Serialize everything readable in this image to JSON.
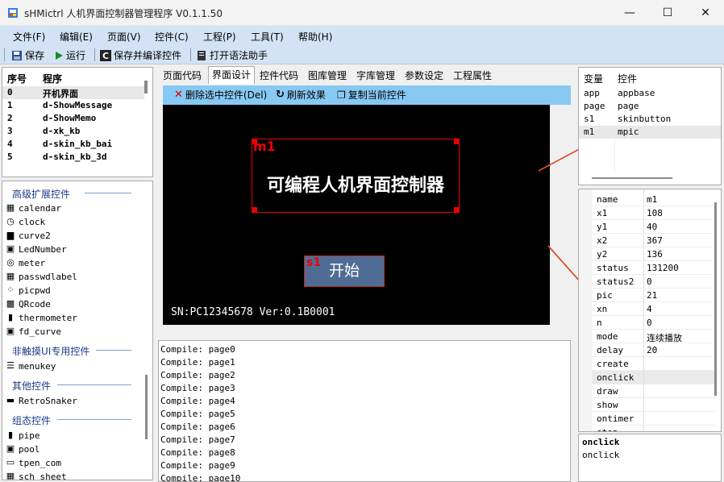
{
  "window": {
    "title": "sHMictrl 人机界面控制器管理程序 V0.1.1.50",
    "min": "—",
    "max": "☐",
    "close": "✕"
  },
  "menu": [
    "文件(F)",
    "编辑(E)",
    "页面(V)",
    "控件(C)",
    "工程(P)",
    "工具(T)",
    "帮助(H)"
  ],
  "toolbar": {
    "save": "保存",
    "run": "运行",
    "save_compile": "保存并编译控件",
    "syntax": "打开语法助手"
  },
  "programs": {
    "header": [
      "序号",
      "程序"
    ],
    "rows": [
      [
        "0",
        "开机界面"
      ],
      [
        "1",
        "d-ShowMessage"
      ],
      [
        "2",
        "d-ShowMemo"
      ],
      [
        "3",
        "d-xk_kb"
      ],
      [
        "4",
        "d-skin_kb_bai"
      ],
      [
        "5",
        "d-skin_kb_3d"
      ]
    ]
  },
  "toolbox": {
    "groups": [
      {
        "title": "高级扩展控件",
        "items": [
          {
            "label": "calendar",
            "icon": "▦"
          },
          {
            "label": "clock",
            "icon": "◷"
          },
          {
            "label": "curve2",
            "icon": "▆"
          },
          {
            "label": "LedNumber",
            "icon": "▣"
          },
          {
            "label": "meter",
            "icon": "◎"
          },
          {
            "label": "passwdlabel",
            "icon": "▦"
          },
          {
            "label": "picpwd",
            "icon": "⁘"
          },
          {
            "label": "QRcode",
            "icon": "▩"
          },
          {
            "label": "thermometer",
            "icon": "▮"
          },
          {
            "label": "fd_curve",
            "icon": "▣"
          }
        ]
      },
      {
        "title": "非触摸UI专用控件",
        "items": [
          {
            "label": "menukey",
            "icon": "☰"
          }
        ]
      },
      {
        "title": "其他控件",
        "items": [
          {
            "label": "RetroSnaker",
            "icon": "▬"
          }
        ]
      },
      {
        "title": "组态控件",
        "items": [
          {
            "label": "pipe",
            "icon": "▮"
          },
          {
            "label": "pool",
            "icon": "▣"
          },
          {
            "label": "tpen_com",
            "icon": "▭"
          },
          {
            "label": "sch_sheet",
            "icon": "▦"
          }
        ]
      }
    ]
  },
  "tabs": [
    "页面代码",
    "界面设计",
    "控件代码",
    "图库管理",
    "字库管理",
    "参数设定",
    "工程属性"
  ],
  "designbar": {
    "delete": "删除选中控件(Del)",
    "refresh": "刷新效果",
    "copy": "复制当前控件"
  },
  "canvas": {
    "m1_label": "m1",
    "m1_text": "可编程人机界面控制器",
    "s1_label": "s1",
    "s1_text": "开始",
    "sn": "SN:PC12345678 Ver:0.1B0001"
  },
  "log": [
    "Compile: page0",
    "Compile: page1",
    "Compile: page2",
    "Compile: page3",
    "Compile: page4",
    "Compile: page5",
    "Compile: page6",
    "Compile: page7",
    "Compile: page8",
    "Compile: page9",
    "Compile: page10"
  ],
  "vars": {
    "header": [
      "变量",
      "控件"
    ],
    "rows": [
      [
        "app",
        "appbase"
      ],
      [
        "page",
        "page"
      ],
      [
        "s1",
        "skinbutton"
      ],
      [
        "m1",
        "mpic"
      ]
    ]
  },
  "props": [
    [
      "name",
      "m1"
    ],
    [
      "x1",
      "108"
    ],
    [
      "y1",
      "40"
    ],
    [
      "x2",
      "367"
    ],
    [
      "y2",
      "136"
    ],
    [
      "status",
      "131200"
    ],
    [
      "status2",
      "0"
    ],
    [
      "pic",
      "21"
    ],
    [
      "xn",
      "4"
    ],
    [
      "n",
      "0"
    ],
    [
      "mode",
      "连续播放"
    ],
    [
      "delay",
      "20"
    ],
    [
      "create",
      ""
    ],
    [
      "onclick",
      ""
    ],
    [
      "draw",
      ""
    ],
    [
      "show",
      ""
    ],
    [
      "ontimer",
      ""
    ],
    [
      "stop",
      ""
    ]
  ],
  "desc": {
    "title": "onclick",
    "text": "onclick"
  },
  "colors": {
    "menubar": "#d3e3f5",
    "designbar": "#88c9f3",
    "selection": "#e00000",
    "button": "#4f6d94"
  }
}
